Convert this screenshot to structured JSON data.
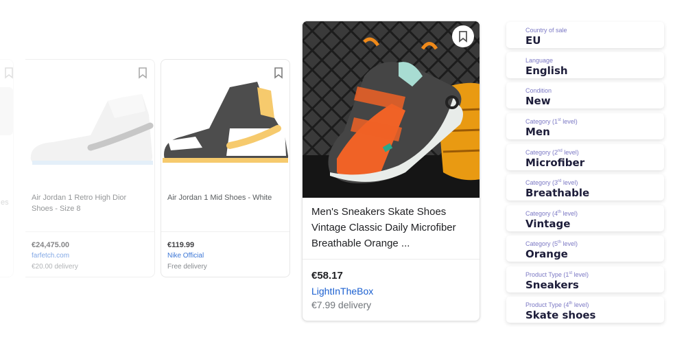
{
  "products": [
    {
      "title": "Air Jordan 1 Retro High Dior Shoes - Size 8",
      "price": "€24,475.00",
      "seller": "farfetch.com",
      "delivery": "€20.00 delivery",
      "icon": "bookmark-icon"
    },
    {
      "title": "Air Jordan 1 Mid Shoes - White",
      "price": "€119.99",
      "seller": "Nike Official",
      "delivery": "Free delivery",
      "icon": "bookmark-icon"
    },
    {
      "title": "Men's Sneakers Skate Shoes Vintage Classic Daily Microfiber Breathable Orange ...",
      "price": "€58.17",
      "seller": "LightInTheBox",
      "delivery": "€7.99 delivery",
      "icon": "bookmark-icon"
    }
  ],
  "partial_card": {
    "title_fragment": "es"
  },
  "attributes": [
    {
      "label": "Country of sale",
      "sup": "",
      "label_suffix": "",
      "value": "EU"
    },
    {
      "label": "Language",
      "sup": "",
      "label_suffix": "",
      "value": "English"
    },
    {
      "label": "Condition",
      "sup": "",
      "label_suffix": "",
      "value": "New"
    },
    {
      "label": "Category (1",
      "sup": "st",
      "label_suffix": " level)",
      "value": "Men"
    },
    {
      "label": "Category (2",
      "sup": "nd",
      "label_suffix": " level)",
      "value": "Microfiber"
    },
    {
      "label": "Category (3",
      "sup": "rd",
      "label_suffix": " level)",
      "value": "Breathable"
    },
    {
      "label": "Category (4",
      "sup": "th",
      "label_suffix": " level)",
      "value": "Vintage"
    },
    {
      "label": "Category (5",
      "sup": "th",
      "label_suffix": " level)",
      "value": "Orange"
    },
    {
      "label": "Product Type (1",
      "sup": "st",
      "label_suffix": " level)",
      "value": "Sneakers"
    },
    {
      "label": "Product Type (4",
      "sup": "th",
      "label_suffix": " level)",
      "value": "Skate shoes"
    }
  ],
  "colors": {
    "seller_link": "#1a5fd0",
    "attr_label": "#7b78c4",
    "attr_value": "#1d1d3a"
  }
}
